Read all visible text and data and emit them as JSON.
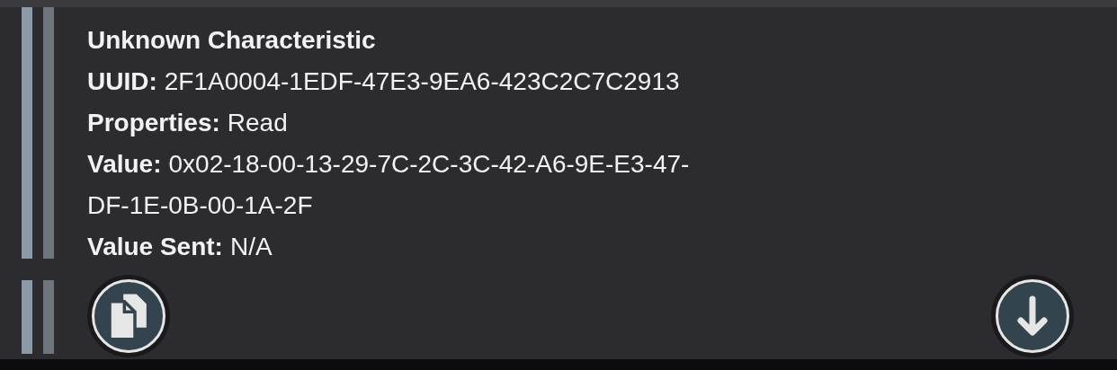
{
  "characteristic": {
    "title": "Unknown Characteristic",
    "fields": [
      {
        "label": "UUID:",
        "lines": [
          "2F1A0004-1EDF-47E3-9EA6-423C2C7C2913"
        ]
      },
      {
        "label": "Properties:",
        "lines": [
          "Read"
        ]
      },
      {
        "label": "Value:",
        "lines": [
          "0x02-18-00-13-29-7C-2C-3C-42-A6-9E-E3-47-",
          "DF-1E-0B-00-1A-2F"
        ]
      },
      {
        "label": "Value Sent:",
        "lines": [
          "N/A"
        ]
      }
    ]
  }
}
